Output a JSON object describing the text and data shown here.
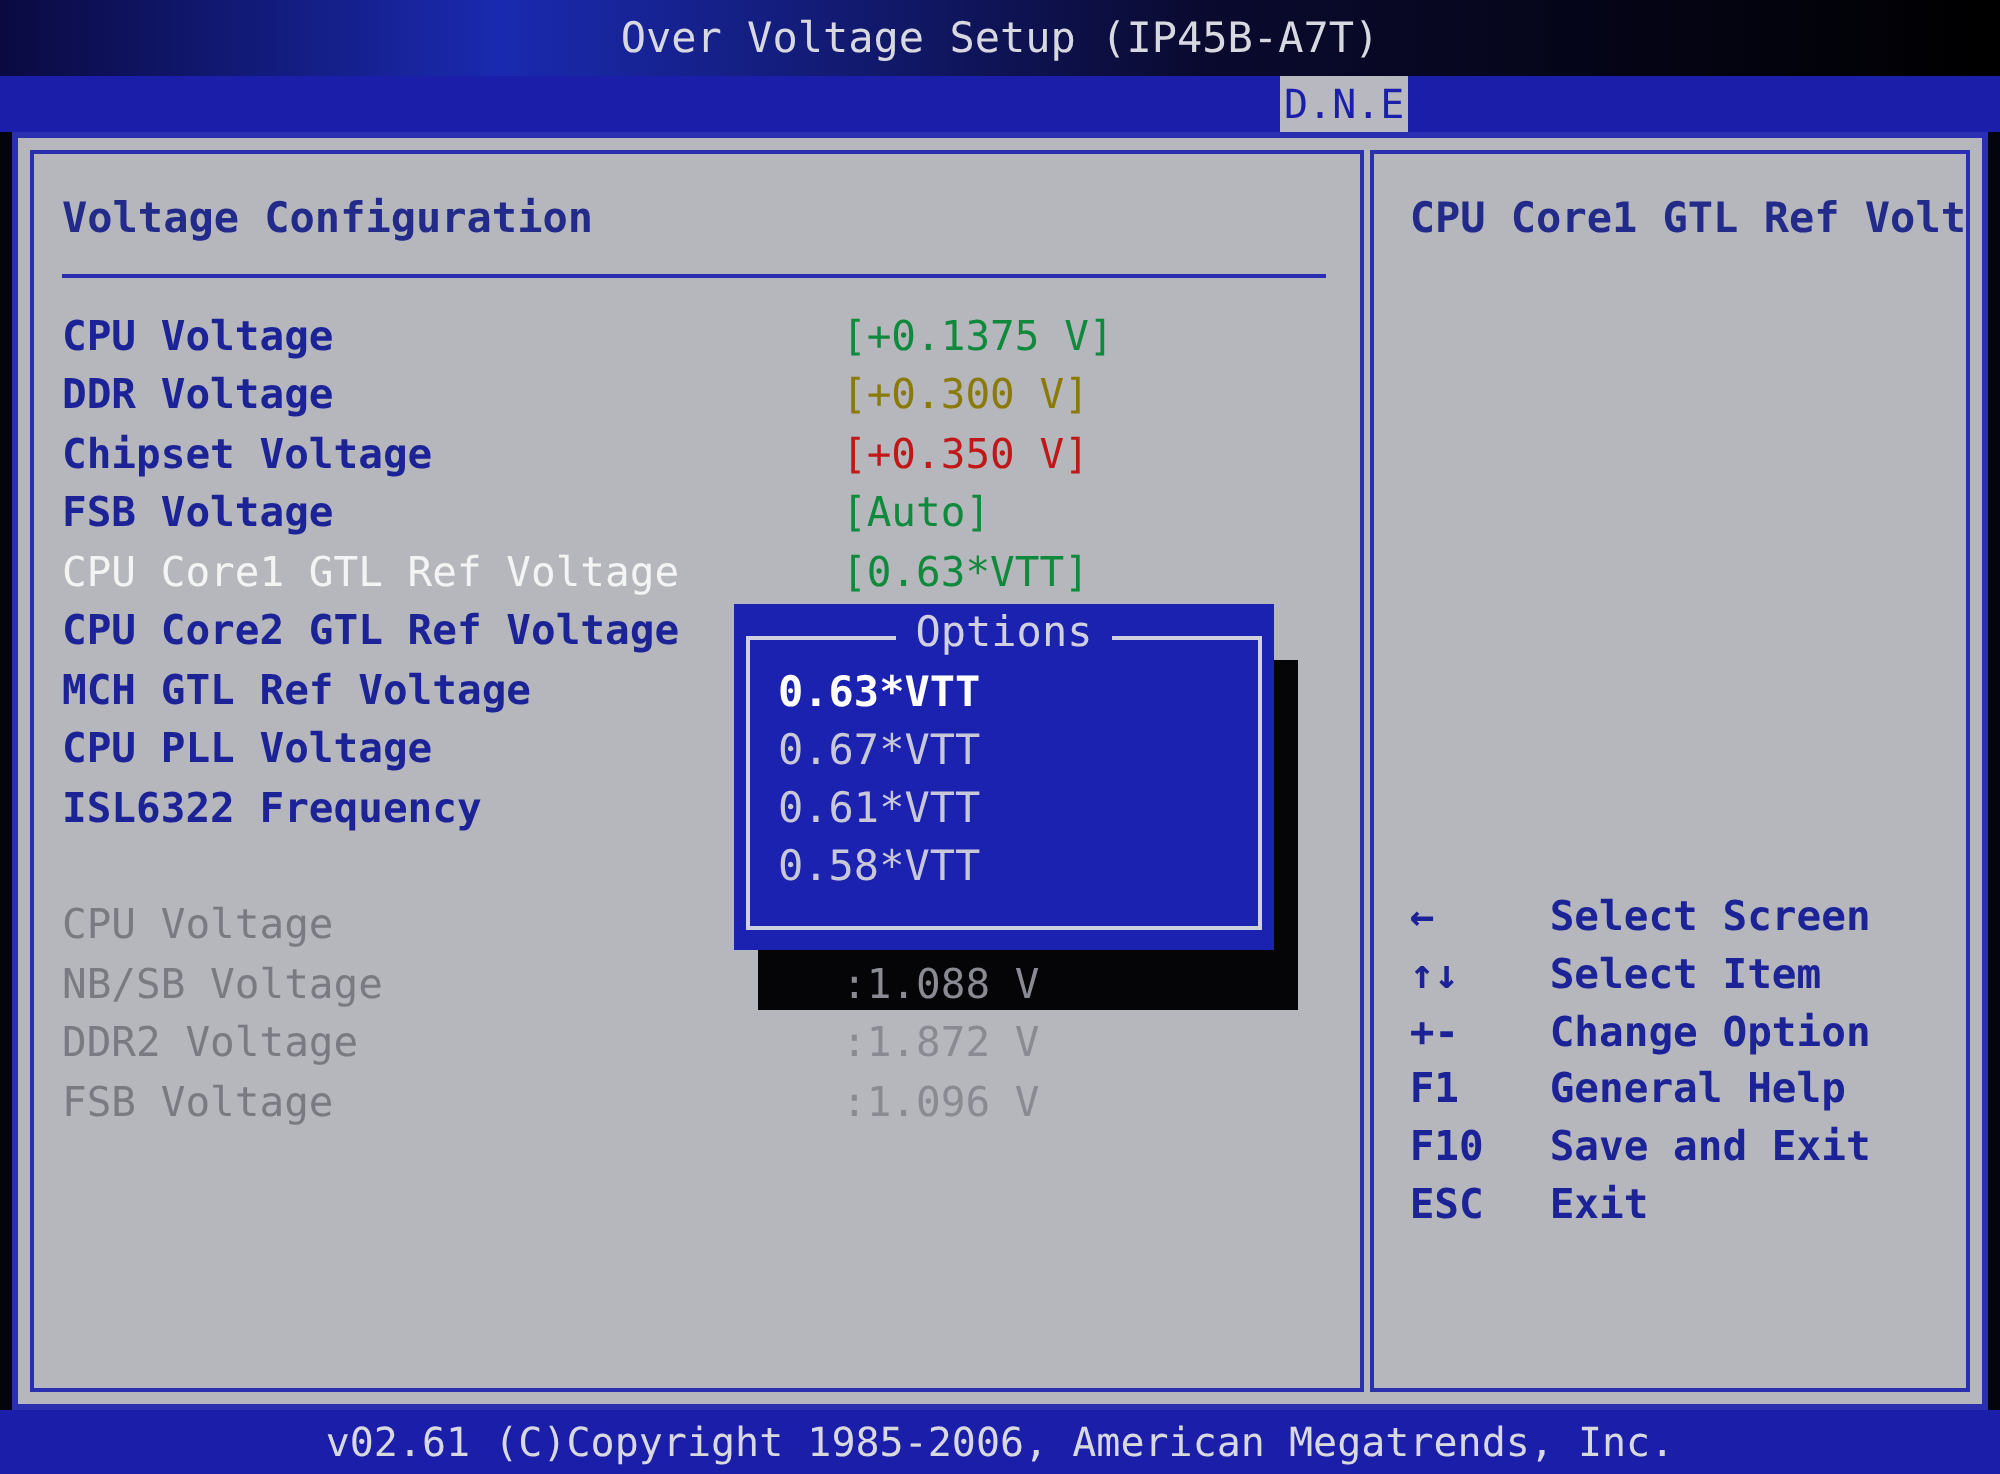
{
  "title": "Over Voltage Setup (IP45B-A7T)",
  "tabs": [
    {
      "label": "D.N.E",
      "selected": true
    }
  ],
  "section_title": "Voltage Configuration",
  "settings": [
    {
      "label": "CPU Voltage",
      "value": "[+0.1375 V]",
      "color": "#0f8a3c",
      "selected": false
    },
    {
      "label": "DDR Voltage",
      "value": "[+0.300 V]",
      "color": "#8a7a08",
      "selected": false
    },
    {
      "label": "Chipset Voltage",
      "value": "[+0.350 V]",
      "color": "#c01818",
      "selected": false
    },
    {
      "label": "FSB Voltage",
      "value": "[Auto]",
      "color": "#0f8a3c",
      "selected": false
    },
    {
      "label": "CPU Core1 GTL Ref Voltage",
      "value": "[0.63*VTT]",
      "color": "#0f8a3c",
      "selected": true
    },
    {
      "label": "CPU Core2 GTL Ref Voltage",
      "selected": false
    },
    {
      "label": "MCH GTL Ref Voltage",
      "selected": false
    },
    {
      "label": "CPU PLL Voltage",
      "selected": false
    },
    {
      "label": "ISL6322 Frequency",
      "selected": false
    }
  ],
  "readings": [
    {
      "label": "CPU Voltage"
    },
    {
      "label": "NB/SB Voltage",
      "value": ":1.088 V"
    },
    {
      "label": "DDR2 Voltage",
      "value": ":1.872 V"
    },
    {
      "label": "FSB Voltage",
      "value": ":1.096 V"
    }
  ],
  "options_popup": {
    "title": "Options",
    "options": [
      {
        "label": "0.63*VTT",
        "selected": true
      },
      {
        "label": "0.67*VTT",
        "selected": false
      },
      {
        "label": "0.61*VTT",
        "selected": false
      },
      {
        "label": "0.58*VTT",
        "selected": false
      }
    ]
  },
  "help_title": "CPU Core1 GTL Ref Volt",
  "key_help": [
    {
      "key": "←",
      "action": "Select Screen"
    },
    {
      "key": "↑↓",
      "action": "Select Item"
    },
    {
      "key": "+-",
      "action": "Change Option"
    },
    {
      "key": "F1",
      "action": "General Help"
    },
    {
      "key": "F10",
      "action": "Save and Exit"
    },
    {
      "key": "ESC",
      "action": "Exit"
    }
  ],
  "footer": "v02.61 (C)Copyright 1985-2006, American Megatrends, Inc."
}
